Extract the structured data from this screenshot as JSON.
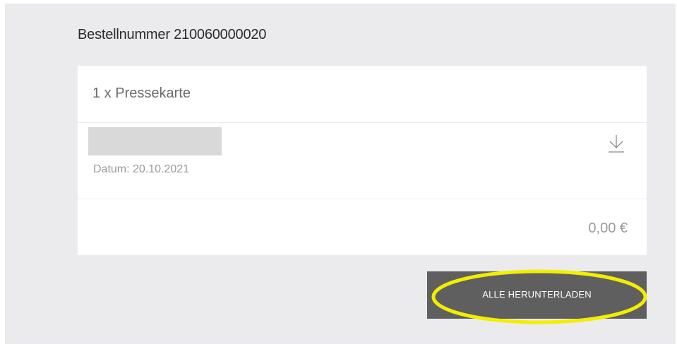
{
  "order": {
    "title": "Bestellnummer 210060000020"
  },
  "ticket_group": {
    "header": "1 x Pressekarte",
    "date": "Datum: 20.10.2021",
    "price": "0,00 €"
  },
  "actions": {
    "download_all_label": "ALLE HERUNTERLADEN"
  },
  "colors": {
    "panel_background": "#ebebed",
    "button_background": "#5f5f5f",
    "highlight": "#f2ee00"
  },
  "icons": {
    "download": "download-icon"
  }
}
